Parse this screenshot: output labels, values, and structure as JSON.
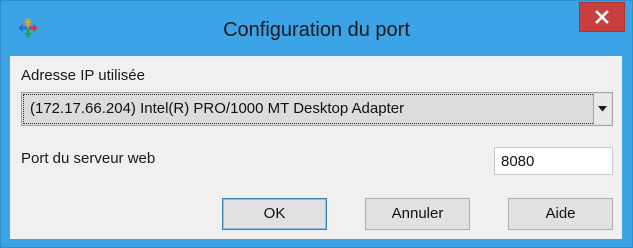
{
  "window": {
    "title": "Configuration du port",
    "icon": "colored-arrows-app-icon",
    "close_icon": "close-x-icon"
  },
  "form": {
    "ip_label": "Adresse IP utilisée",
    "ip_selected": "(172.17.66.204) Intel(R) PRO/1000 MT Desktop Adapter",
    "dropdown_icon": "dropdown-arrow-icon",
    "port_label": "Port du serveur web",
    "port_value": "8080"
  },
  "buttons": {
    "ok": "OK",
    "cancel": "Annuler",
    "help": "Aide"
  },
  "colors": {
    "frame": "#3ba3e6",
    "close": "#c8403d",
    "client_bg": "#f0f0f0"
  }
}
